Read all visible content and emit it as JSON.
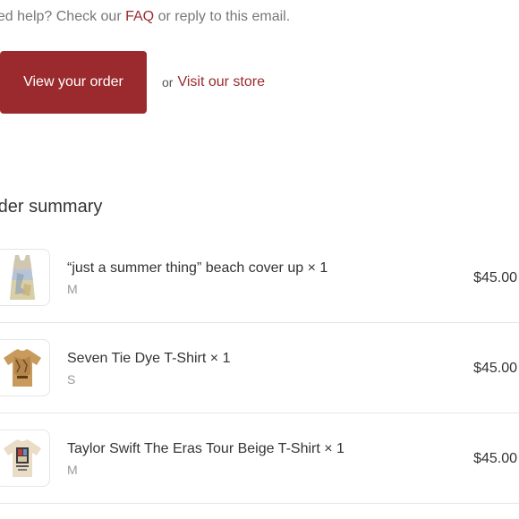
{
  "help": {
    "prefix": "eed help? Check our ",
    "faq_link": "FAQ",
    "suffix": " or reply to this email."
  },
  "actions": {
    "view_order_label": "View your order",
    "or_text": "or",
    "visit_store_label": "Visit our store"
  },
  "summary": {
    "title": "rder summary",
    "items": [
      {
        "title": "“just a summer thing” beach cover up × 1",
        "variant": "M",
        "price": "$45.00",
        "image": "cover-up-dress-image"
      },
      {
        "title": "Seven Tie Dye T-Shirt × 1",
        "variant": "S",
        "price": "$45.00",
        "image": "tie-dye-tshirt-image"
      },
      {
        "title": "Taylor Swift The Eras Tour Beige T-Shirt × 1",
        "variant": "M",
        "price": "$45.00",
        "image": "eras-tour-tshirt-image"
      }
    ]
  },
  "colors": {
    "accent": "#9b2a2e",
    "text": "#333333",
    "muted": "#999999",
    "divider": "#e5e5e5"
  }
}
